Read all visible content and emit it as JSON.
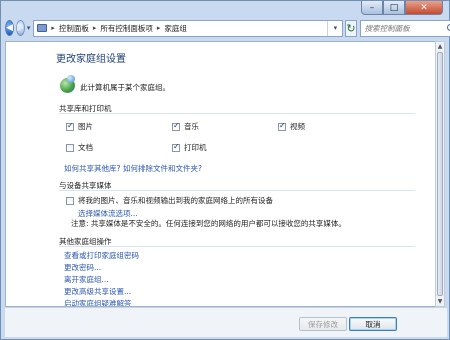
{
  "window": {
    "controls": {
      "minimize": "–",
      "maximize": "□",
      "close": "✕"
    }
  },
  "address_bar": {
    "crumbs": [
      "控制面板",
      "所有控制面板项",
      "家庭组"
    ],
    "separator": "▸",
    "dropdown": "▾",
    "refresh": "↻"
  },
  "search": {
    "placeholder": "搜索控制面板"
  },
  "page": {
    "title": "更改家庭组设置",
    "status": "此计算机属于某个家庭组。"
  },
  "shared_libraries": {
    "heading": "共享库和打印机",
    "items": [
      {
        "label": "图片",
        "checked": true
      },
      {
        "label": "音乐",
        "checked": true
      },
      {
        "label": "视频",
        "checked": true
      },
      {
        "label": "文档",
        "checked": false
      },
      {
        "label": "打印机",
        "checked": true
      }
    ],
    "link_share_other": "如何共享其他库?",
    "link_exclude": "如何排除文件和文件夹?"
  },
  "media": {
    "heading": "与设备共享媒体",
    "stream_label": "将我的图片、音乐和视频输出到我的家庭网络上的所有设备",
    "stream_checked": false,
    "choose_options_link": "选择媒体流选项...",
    "note": "注意: 共享媒体是不安全的。任何连接到您的网络的用户都可以接收您的共享媒体。"
  },
  "other_actions": {
    "heading": "其他家庭组操作",
    "links": [
      "查看或打印家庭组密码",
      "更改密码...",
      "离开家庭组...",
      "更改高级共享设置...",
      "启动家庭组疑难解答"
    ]
  },
  "buttons": {
    "save": "保存修改",
    "cancel": "取消"
  }
}
